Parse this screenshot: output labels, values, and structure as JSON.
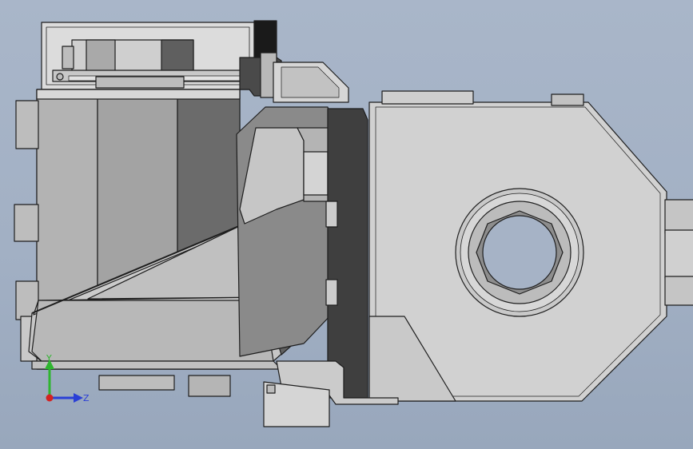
{
  "viewport": {
    "background_top": "#a9b6c9",
    "background_bottom": "#98a7bc"
  },
  "model": {
    "edge_color": "#1e1e1e",
    "face_light": "#d2d2d2",
    "face_mid": "#a8a8a8",
    "face_dark": "#5a5a5a"
  },
  "triad": {
    "y_label": "Y",
    "z_label": "Z",
    "y_color": "#2fb52f",
    "z_color": "#2a3fd6",
    "origin_color": "#d42222"
  }
}
